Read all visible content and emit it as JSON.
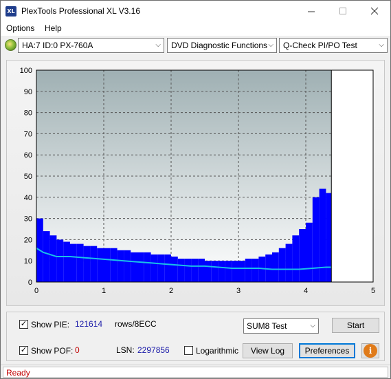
{
  "window": {
    "title": "PlexTools Professional XL V3.16",
    "icon_text": "XL"
  },
  "menu": [
    {
      "label": "Options"
    },
    {
      "label": "Help"
    }
  ],
  "toolbar": {
    "drive": "HA:7 ID:0  PX-760A",
    "function": "DVD Diagnostic Functions",
    "test": "Q-Check PI/PO Test"
  },
  "chart_data": {
    "type": "area",
    "x_ticks": [
      "0",
      "1",
      "2",
      "3",
      "4",
      "5"
    ],
    "y_ticks": [
      "0",
      "10",
      "20",
      "30",
      "40",
      "50",
      "60",
      "70",
      "80",
      "90",
      "100"
    ],
    "xlim": [
      0,
      5
    ],
    "ylim": [
      0,
      100
    ],
    "grid": true,
    "end_marker_x": 4.38,
    "series": [
      {
        "type": "bar",
        "color": "#0000ff",
        "x": [
          0.0,
          0.1,
          0.2,
          0.3,
          0.4,
          0.5,
          0.6,
          0.7,
          0.8,
          0.9,
          1.0,
          1.1,
          1.2,
          1.3,
          1.4,
          1.5,
          1.6,
          1.7,
          1.8,
          1.9,
          2.0,
          2.1,
          2.2,
          2.3,
          2.4,
          2.5,
          2.6,
          2.7,
          2.8,
          2.9,
          3.0,
          3.1,
          3.2,
          3.3,
          3.4,
          3.5,
          3.6,
          3.7,
          3.8,
          3.9,
          4.0,
          4.1,
          4.2,
          4.3,
          4.38
        ],
        "values": [
          30,
          24,
          22,
          20,
          19,
          18,
          18,
          17,
          17,
          16,
          16,
          16,
          15,
          15,
          14,
          14,
          14,
          13,
          13,
          13,
          12,
          11,
          11,
          11,
          11,
          10,
          10,
          10,
          10,
          10,
          10,
          11,
          11,
          12,
          13,
          14,
          16,
          18,
          22,
          25,
          28,
          40,
          44,
          42,
          38
        ]
      },
      {
        "type": "line",
        "color": "#19c0e8",
        "x": [
          0.0,
          0.1,
          0.2,
          0.3,
          0.5,
          0.7,
          0.9,
          1.1,
          1.3,
          1.5,
          1.7,
          1.9,
          2.1,
          2.3,
          2.5,
          2.7,
          2.9,
          3.1,
          3.3,
          3.5,
          3.7,
          3.9,
          4.1,
          4.3,
          4.38
        ],
        "values": [
          16,
          14,
          13,
          12,
          12,
          11.5,
          11,
          10.5,
          10,
          9.5,
          9,
          8.5,
          8,
          7.5,
          7.5,
          7,
          6.5,
          6.5,
          6.5,
          6,
          6,
          6,
          6.5,
          7,
          7
        ]
      }
    ]
  },
  "controls": {
    "show_pie_label": "Show PIE:",
    "pie_value": "121614",
    "rows_label": "rows/8ECC",
    "show_pof_label": "Show POF:",
    "pof_value": "0",
    "lsn_label": "LSN:",
    "lsn_value": "2297856",
    "log_label": "Logarithmic",
    "test_select": "SUM8 Test",
    "start_label": "Start",
    "viewlog_label": "View Log",
    "prefs_label": "Preferences",
    "info_glyph": "i"
  },
  "status": {
    "text": "Ready"
  }
}
